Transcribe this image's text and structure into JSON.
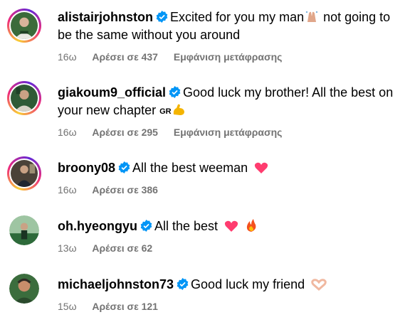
{
  "comments": [
    {
      "username": "alistairjohnston",
      "text_a": "Excited for you my man",
      "text_b": " not going to be the same without you around",
      "emoji": "praying-hands",
      "time": "16ω",
      "likes": "Αρέσει σε 437",
      "translate": "Εμφάνιση μετάφρασης",
      "ring": true,
      "avatar_colors": [
        "#3b6b3a",
        "#e9e9e2",
        "#1e3f22"
      ]
    },
    {
      "username": "giakoum9_official",
      "text_a": "Good luck my brother! All the best on your new chapter",
      "text_b": "",
      "flag_text": "GR",
      "emoji": "flexed-biceps",
      "time": "16ω",
      "likes": "Αρέσει σε 295",
      "translate": "Εμφάνιση μετάφρασης",
      "ring": true,
      "avatar_colors": [
        "#2f5a36",
        "#d7d2c6",
        "#204028"
      ]
    },
    {
      "username": "broony08",
      "text_a": "All the best weeman",
      "text_b": "",
      "emoji": "pink-heart",
      "time": "16ω",
      "likes": "Αρέσει σε 386",
      "ring": true,
      "avatar_colors": [
        "#4a4238",
        "#1d2530",
        "#9b8e73"
      ]
    },
    {
      "username": "oh.hyeongyu",
      "text_a": "All the best",
      "text_b": "",
      "emoji": "heart-fire",
      "time": "13ω",
      "likes": "Αρέσει σε 62",
      "ring": false,
      "avatar_colors": [
        "#2d6a3a",
        "#9ec5a2",
        "#1a3322"
      ]
    },
    {
      "username": "michaeljohnston73",
      "text_a": "Good luck my friend",
      "text_b": "",
      "emoji": "heart-hands",
      "time": "15ω",
      "likes": "Αρέσει σε 121",
      "ring": false,
      "avatar_colors": [
        "#3b6d3d",
        "#c98d6b",
        "#2a4a2c"
      ]
    }
  ],
  "colors": {
    "verified": "#0095f6",
    "meta": "#737373",
    "heart": "#ff3c6f"
  }
}
